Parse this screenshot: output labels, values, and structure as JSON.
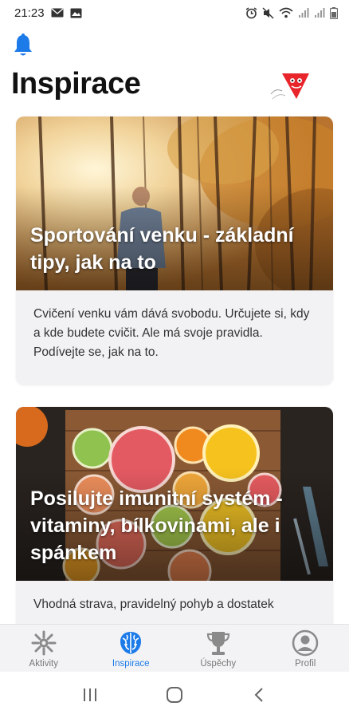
{
  "status_bar": {
    "time": "21:23",
    "left_icons": [
      "mail-icon",
      "image-icon"
    ],
    "right_icons": [
      "alarm-icon",
      "mute-icon",
      "wifi-icon",
      "signal-icon",
      "signal-icon",
      "battery-icon"
    ]
  },
  "header": {
    "title": "Inspirace",
    "bell_icon": "bell-icon",
    "logo": "brand-logo",
    "accent_color": "#1c7be8",
    "logo_color": "#e8252b"
  },
  "cards": [
    {
      "title": "Sportování venku - základní tipy, jak na to",
      "text": "Cvičení venku vám dává svobodu. Určujete si, kdy a kde budete cvičit. Ale má svoje pravidla. Podívejte se, jak na to.",
      "image": "autumn-forest-runner"
    },
    {
      "title": "Posilujte imunitní systém - vitaminy, bílkovinami, ale i spánkem",
      "text": "Vhodná strava, pravidelný pohyb a dostatek",
      "image": "citrus-fruit-board"
    }
  ],
  "bottom_nav": {
    "items": [
      {
        "label": "Aktivity",
        "icon": "activity-icon",
        "active": false
      },
      {
        "label": "Inspirace",
        "icon": "brain-icon",
        "active": true
      },
      {
        "label": "Úspěchy",
        "icon": "trophy-icon",
        "active": false
      },
      {
        "label": "Profil",
        "icon": "profile-icon",
        "active": false
      }
    ]
  },
  "system_nav": {
    "buttons": [
      "recent-apps-icon",
      "home-icon",
      "back-icon"
    ]
  }
}
